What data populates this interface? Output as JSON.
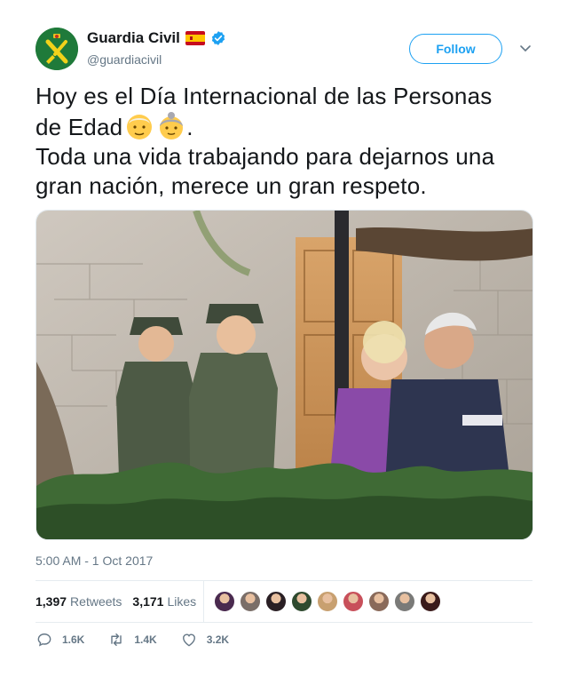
{
  "header": {
    "display_name": "Guardia Civil",
    "handle": "@guardiacivil",
    "follow_label": "Follow"
  },
  "tweet": {
    "line1": "Hoy es el Día Internacional de las Personas",
    "line2": "de Edad",
    "line2_end": ".",
    "line3": "Toda una vida trabajando para dejarnos una",
    "line4": "gran nación, merece un gran respeto."
  },
  "timestamp": "5:00 AM - 1 Oct 2017",
  "stats": {
    "retweets_count": "1,397",
    "retweets_label": "Retweets",
    "likes_count": "3,171",
    "likes_label": "Likes"
  },
  "actions": {
    "replies": "1.6K",
    "retweets": "1.4K",
    "likes": "3.2K"
  },
  "likers": [
    "#4a2a4f",
    "#7a6e68",
    "#2a1f24",
    "#2f4a2f",
    "#c8a070",
    "#c8505a",
    "#8a6a5a",
    "#7a7a78",
    "#3a1a1a"
  ],
  "colors": {
    "accent": "#1da1f2",
    "muted": "#657786",
    "avatar_green": "#1f7a3a"
  },
  "icons": [
    "guardia-civil-logo-icon",
    "spain-flag-icon",
    "verified-badge-icon",
    "chevron-down-icon",
    "older-man-emoji-icon",
    "older-woman-emoji-icon",
    "reply-icon",
    "retweet-icon",
    "like-heart-icon"
  ]
}
